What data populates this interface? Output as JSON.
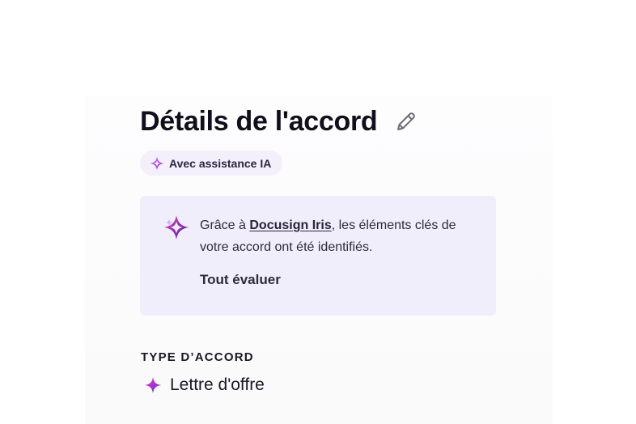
{
  "agreement": {
    "title": "Détails de l'accord",
    "ai_badge": "Avec assistance IA",
    "iris_card": {
      "text_before": "Grâce à ",
      "link_text": "Docusign Iris",
      "text_after": ", les éléments clés de votre accord ont été identifiés.",
      "review_link": "Tout évaluer"
    },
    "type_section": {
      "label": "TYPE D’ACCORD",
      "value": "Lettre d'offre"
    }
  },
  "colors": {
    "sparkle_start": "#c026d3",
    "sparkle_end": "#5b21b6",
    "card_bg": "#f1eefb"
  },
  "icons": {
    "edit": "pencil-icon",
    "ai": "sparkle-icon"
  }
}
